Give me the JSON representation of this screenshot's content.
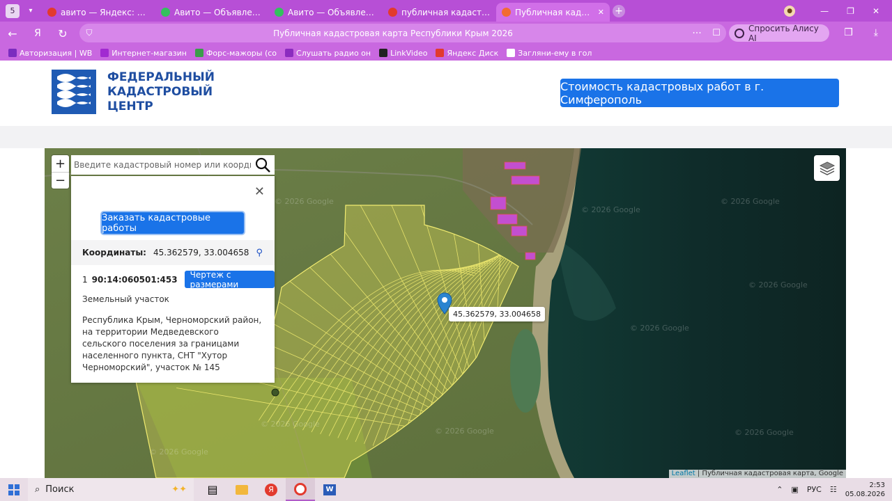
{
  "browser": {
    "tab_counter": "5",
    "tabs": [
      {
        "title": "авито — Яндекс: нашлось",
        "favicon_color": "#e23a2e"
      },
      {
        "title": "Авито — Объявления на сайте",
        "favicon_color": "#33c15d"
      },
      {
        "title": "Авито — Объявления на сайте",
        "favicon_color": "#33c15d"
      },
      {
        "title": "публичная кадастровая карта",
        "favicon_color": "#e23a2e"
      },
      {
        "title": "Публичная кадастровая",
        "favicon_color": "#f26b32",
        "active": true
      }
    ],
    "page_title": "Публичная кадастровая карта Республики Крым 2026",
    "alice_label": "Спросить Алису AI",
    "bookmarks": [
      {
        "label": "Авторизация | WB",
        "color": "#7b2cbf"
      },
      {
        "label": "Интернет-магазин",
        "color": "#a12ad1"
      },
      {
        "label": "Форс-мажоры (со",
        "color": "#3a9d4a"
      },
      {
        "label": "Слушать радио он",
        "color": "#8b2cbf"
      },
      {
        "label": "LinkVideo",
        "color": "#222222"
      },
      {
        "label": "Яндекс Диск",
        "color": "#e23a2e"
      },
      {
        "label": "Загляни-ему в гол",
        "color": "#ffffff"
      }
    ]
  },
  "site": {
    "logo_lines": [
      "ФЕДЕРАЛЬНЫЙ",
      "КАДАСТРОВЫЙ",
      "ЦЕНТР"
    ],
    "cost_button": "Стоимость кадастровых работ в г. Симферополь"
  },
  "map": {
    "search_placeholder": "Введите кадастровый номер или координаты",
    "zoom_in": "+",
    "zoom_out": "−",
    "watermark": "© 2026 Google",
    "marker_label": "45.362579, 33.004658",
    "attribution_link": "Leaflet",
    "attribution_text": " | Публичная кадастровая карта, Google"
  },
  "popup": {
    "close": "✕",
    "order_button": "Заказать кадастровые работы",
    "coords_label": "Координаты:",
    "coords_value": "45.362579, 33.004658",
    "parcel_index": "1",
    "parcel_number": "90:14:060501:453",
    "drawing_button": "Чертеж с размерами",
    "parcel_type": "Земельный участок",
    "address": "Республика Крым, Черноморский район, на территории Медведевского сельского поселения за границами населенного пункта, СНТ \"Хутор Черноморский\", участок № 145"
  },
  "taskbar": {
    "search_label": "Поиск",
    "language": "РУС",
    "time": "2:53",
    "date": "05.08.2026"
  }
}
